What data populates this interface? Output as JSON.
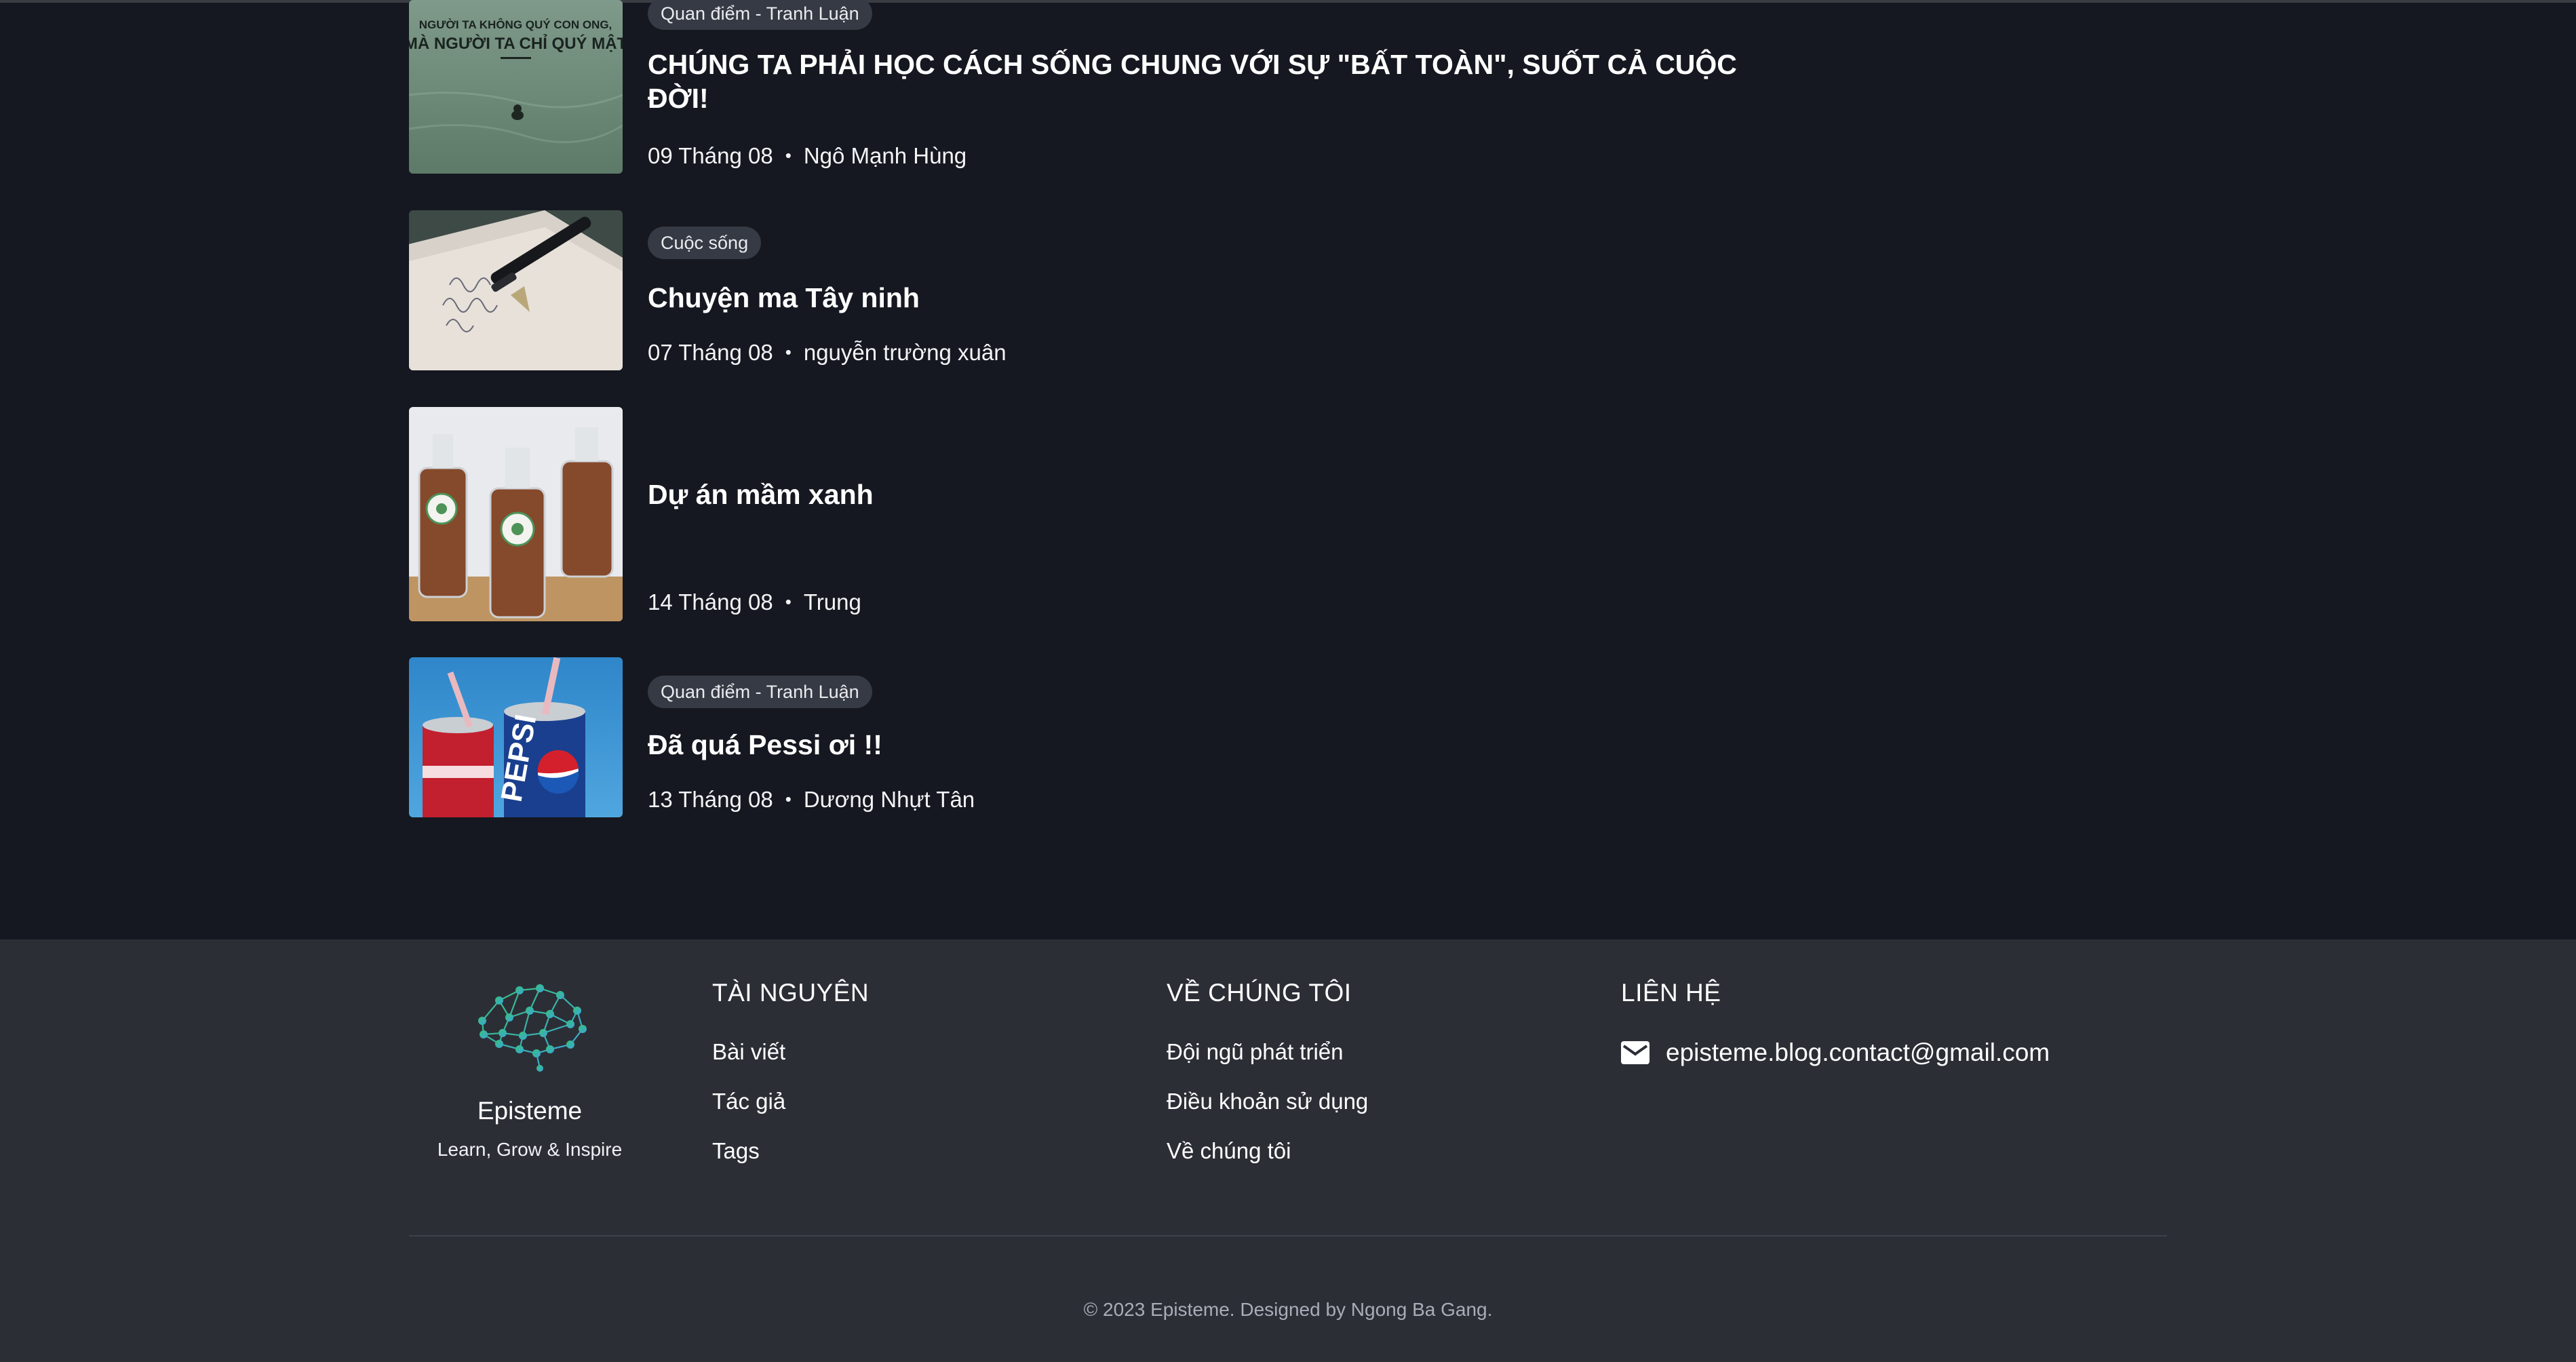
{
  "articles": [
    {
      "tag": "Quan điểm - Tranh Luận",
      "title": "CHÚNG TA PHẢI HỌC CÁCH SỐNG CHUNG VỚI SỰ \"BẤT TOÀN\", SUỐT CẢ CUỘC ĐỜI!",
      "date": "09 Tháng 08",
      "author": "Ngô Mạnh Hùng",
      "thumb_text_1": "NGƯỜI TA KHÔNG QUÝ CON ONG,",
      "thumb_text_2": "MÀ NGƯỜI TA CHỈ QUÝ MẬT"
    },
    {
      "tag": "Cuộc sống",
      "title": "Chuyện ma Tây ninh",
      "date": "07 Tháng 08",
      "author": "nguyễn trường xuân"
    },
    {
      "tag": "",
      "title": "Dự án mầm xanh",
      "date": "14 Tháng 08",
      "author": "Trung"
    },
    {
      "tag": "Quan điểm - Tranh Luận",
      "title": "Đã quá Pessi ơi !!",
      "date": "13 Tháng 08",
      "author": "Dương Nhựt Tân",
      "thumb_text_1": "PEPSI"
    }
  ],
  "byline_separator": "•",
  "footer": {
    "brand_name": "Episteme",
    "brand_tagline": "Learn, Grow & Inspire",
    "resources": {
      "heading": "TÀI NGUYÊN",
      "links": [
        "Bài viết",
        "Tác giả",
        "Tags"
      ]
    },
    "about": {
      "heading": "VỀ CHÚNG TÔI",
      "links": [
        "Đội ngũ phát triển",
        "Điều khoản sử dụng",
        "Về chúng tôi"
      ]
    },
    "contact": {
      "heading": "LIÊN HỆ",
      "email": "episteme.blog.contact@gmail.com",
      "icon": "mail-icon"
    },
    "copyright": "© 2023 Episteme. Designed by Ngong Ba Gang."
  },
  "colors": {
    "page_bg": "#151820",
    "footer_bg": "#2c2e36",
    "tag_bg": "#363a44"
  }
}
